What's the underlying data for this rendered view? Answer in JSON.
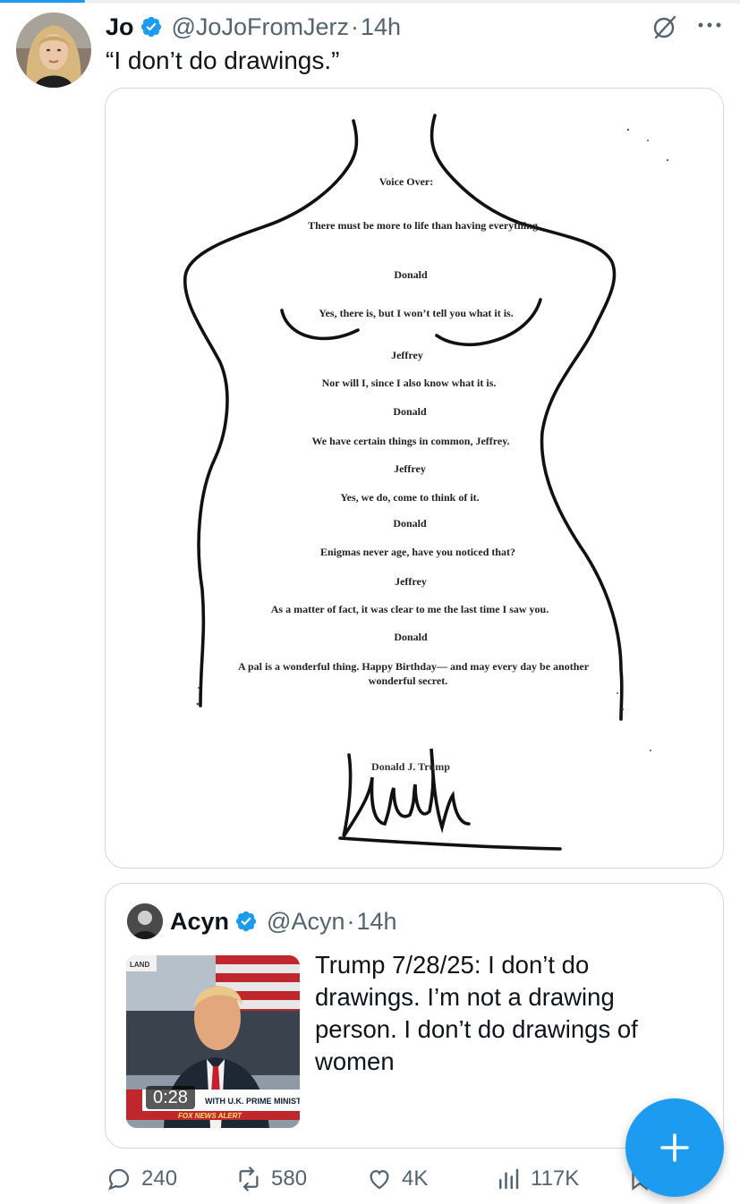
{
  "tweet": {
    "author": {
      "display_name": "Jo",
      "handle": "@JoJoFromJerz",
      "separator": "·",
      "time": "14h",
      "verified": true
    },
    "text": "“I don’t do drawings.”",
    "media": {
      "letter": {
        "voice_over": "Voice Over:",
        "lines": [
          "There must be more to life than having everything.",
          "Donald",
          "Yes, there is, but I won’t tell you what it is.",
          "Jeffrey",
          "Nor will I, since I also know what it is.",
          "Donald",
          "We have certain things in common, Jeffrey.",
          "Jeffrey",
          "Yes, we do, come to think of it.",
          "Donald",
          "Enigmas never age, have you noticed that?",
          "Jeffrey",
          "As a matter of fact, it was clear to me the last time I saw you.",
          "Donald",
          "A pal is a wonderful thing. Happy Birthday— and may every day be another",
          "wonderful secret.",
          "Donald J. Trump"
        ]
      }
    },
    "stats": {
      "replies": "240",
      "reposts": "580",
      "likes": "4K",
      "views": "117K"
    }
  },
  "quote": {
    "author": {
      "display_name": "Acyn",
      "handle": "@Acyn",
      "separator": "·",
      "time": "14h",
      "verified": true
    },
    "text": "Trump 7/28/25: I don’t do drawings. I’m not a drawing person. I don’t do drawings of women",
    "video": {
      "duration": "0:28",
      "chyron": "WITH U.K. PRIME MINISTE",
      "ticker": "FOX NEWS ALERT"
    }
  },
  "icons": {
    "verified": "verified-badge-icon",
    "grok": "grok-icon",
    "more": "more-icon",
    "reply": "reply-icon",
    "repost": "repost-icon",
    "like": "like-icon",
    "views": "views-icon",
    "bookmark": "bookmark-icon",
    "compose": "compose-plus-icon"
  },
  "colors": {
    "accent": "#1d9bf0",
    "secondary_text": "#536471",
    "primary_text": "#0f1419",
    "border": "#cfd9de"
  }
}
